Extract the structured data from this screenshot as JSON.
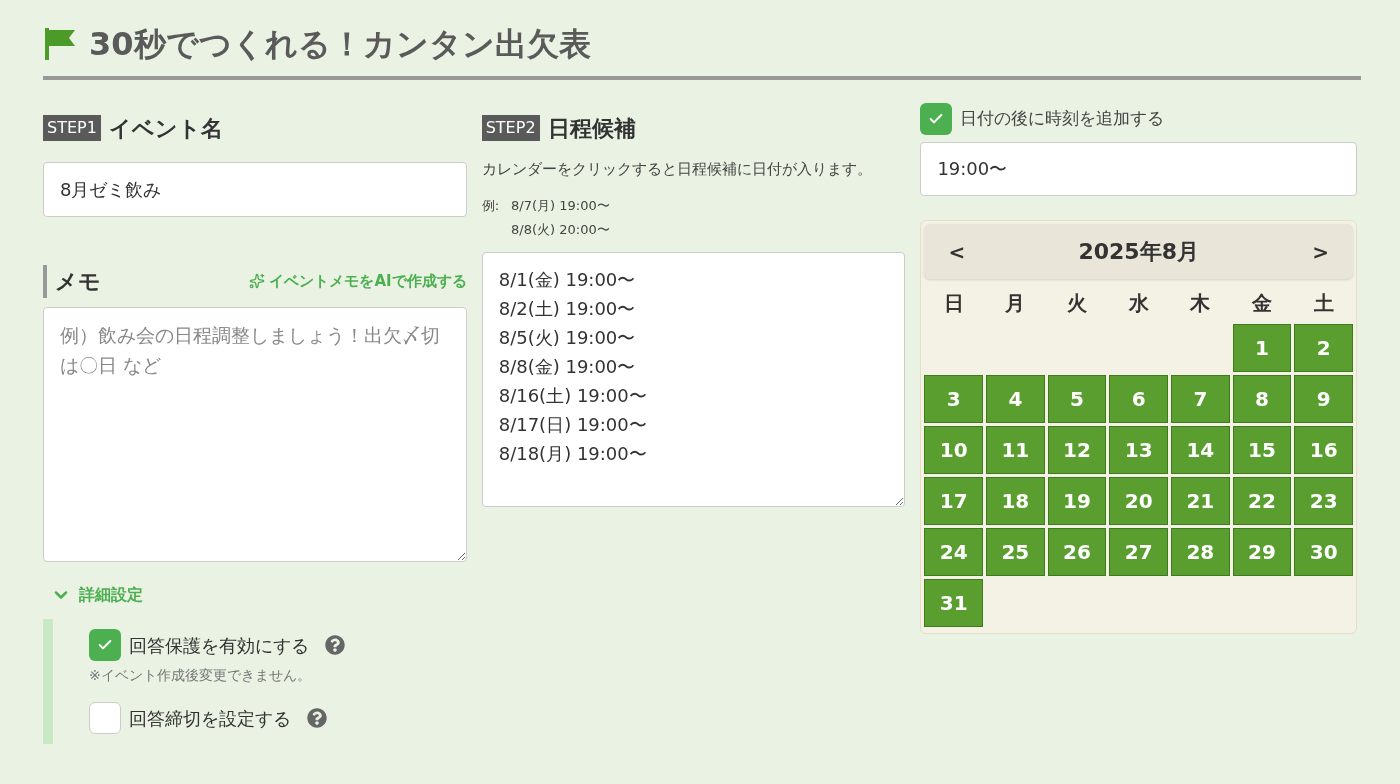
{
  "title": "30秒でつくれる！カンタン出欠表",
  "step1": {
    "badge": "STEP1",
    "heading": "イベント名",
    "event_name": {
      "value": "8月ゼミ飲み"
    }
  },
  "memo": {
    "heading": "メモ",
    "ai_link": "イベントメモをAIで作成する",
    "field": {
      "placeholder": "例）飲み会の日程調整しましょう！出欠〆切は〇日 など"
    }
  },
  "advanced": {
    "label": "詳細設定",
    "expanded": true,
    "options": [
      {
        "label": "回答保護を有効にする",
        "checked": true,
        "note": "※イベント作成後変更できません。"
      },
      {
        "label": "回答締切を設定する",
        "checked": false
      }
    ]
  },
  "step2": {
    "badge": "STEP2",
    "heading": "日程候補",
    "description": "カレンダーをクリックすると日程候補に日付が入ります。",
    "example_label": "例:",
    "examples": [
      "8/7(月) 19:00〜",
      "8/8(火) 20:00〜"
    ],
    "dates": {
      "value": "8/1(金) 19:00〜\n8/2(土) 19:00〜\n8/5(火) 19:00〜\n8/8(金) 19:00〜\n8/16(土) 19:00〜\n8/17(日) 19:00〜\n8/18(月) 19:00〜"
    }
  },
  "time_option": {
    "label": "日付の後に時刻を追加する",
    "checked": true,
    "field": {
      "value": "19:00〜"
    }
  },
  "calendar": {
    "prev": "<",
    "month": "2025年8月",
    "next": ">",
    "weekdays": [
      "日",
      "月",
      "火",
      "水",
      "木",
      "金",
      "土"
    ],
    "cells": [
      {
        "kind": "blank"
      },
      {
        "kind": "blank"
      },
      {
        "kind": "blank"
      },
      {
        "kind": "blank"
      },
      {
        "kind": "blank"
      },
      {
        "kind": "day",
        "day": "1",
        "selected": true
      },
      {
        "kind": "day",
        "day": "2",
        "selected": true
      },
      {
        "kind": "day",
        "day": "3",
        "selected": true
      },
      {
        "kind": "day",
        "day": "4",
        "selected": true
      },
      {
        "kind": "day",
        "day": "5",
        "selected": true
      },
      {
        "kind": "day",
        "day": "6",
        "selected": true
      },
      {
        "kind": "day",
        "day": "7",
        "selected": true
      },
      {
        "kind": "day",
        "day": "8",
        "selected": true
      },
      {
        "kind": "day",
        "day": "9",
        "selected": true
      },
      {
        "kind": "day",
        "day": "10",
        "selected": true
      },
      {
        "kind": "day",
        "day": "11",
        "selected": true
      },
      {
        "kind": "day",
        "day": "12",
        "selected": true
      },
      {
        "kind": "day",
        "day": "13",
        "selected": true
      },
      {
        "kind": "day",
        "day": "14",
        "selected": true
      },
      {
        "kind": "day",
        "day": "15",
        "selected": true
      },
      {
        "kind": "day",
        "day": "16",
        "selected": true
      },
      {
        "kind": "day",
        "day": "17",
        "selected": true
      },
      {
        "kind": "day",
        "day": "18",
        "selected": true
      },
      {
        "kind": "day",
        "day": "19",
        "selected": true
      },
      {
        "kind": "day",
        "day": "20",
        "selected": true
      },
      {
        "kind": "day",
        "day": "21",
        "selected": true
      },
      {
        "kind": "day",
        "day": "22",
        "selected": true
      },
      {
        "kind": "day",
        "day": "23",
        "selected": true
      },
      {
        "kind": "day",
        "day": "24",
        "selected": true
      },
      {
        "kind": "day",
        "day": "25",
        "selected": true
      },
      {
        "kind": "day",
        "day": "26",
        "selected": true
      },
      {
        "kind": "day",
        "day": "27",
        "selected": true
      },
      {
        "kind": "day",
        "day": "28",
        "selected": true
      },
      {
        "kind": "day",
        "day": "29",
        "selected": true
      },
      {
        "kind": "day",
        "day": "30",
        "selected": true
      },
      {
        "kind": "day",
        "day": "31",
        "selected": true
      }
    ]
  }
}
